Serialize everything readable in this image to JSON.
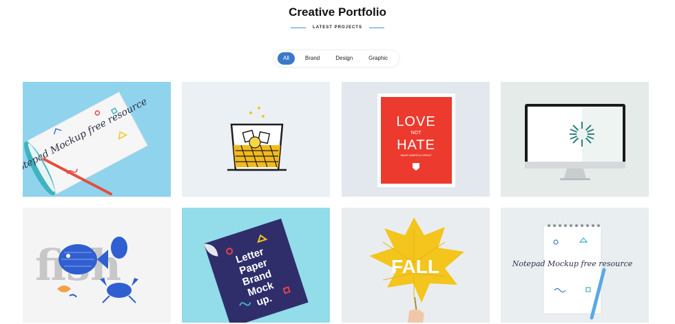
{
  "header": {
    "title": "Creative Portfolio",
    "subtitle": "LATEST PROJECTS"
  },
  "filters": {
    "items": [
      "All",
      "Brand",
      "Design",
      "Graphic"
    ],
    "active": "All"
  },
  "portfolio": {
    "items": [
      {
        "name": "notepad-mockup",
        "text": "Notepad Mockup free resource",
        "bg": "#8fd3ec"
      },
      {
        "name": "whiskey-glass",
        "text": "",
        "bg": "#eaf0f3"
      },
      {
        "name": "love-not-hate-poster",
        "text": "LOVE NOT HATE",
        "small": "MAKE AMERICA GREAT",
        "bg": "#e3e8ef"
      },
      {
        "name": "imac-mockup",
        "text": "",
        "bg": "#e5ebe9"
      },
      {
        "name": "fish-crab-art",
        "text": "fish",
        "bg": "#f4f4f4"
      },
      {
        "name": "letter-paper-mockup",
        "text": "Letter Paper Brand Mock up.",
        "bg": "#93dce9"
      },
      {
        "name": "fall-leaf",
        "text": "FALL",
        "bg": "#e9edf0"
      },
      {
        "name": "notepad-spiral",
        "text": "Notepad Mockup free resource",
        "bg": "#e9eef0"
      }
    ]
  },
  "colors": {
    "accent": "#3a78c8",
    "divider": "#3d8fd8",
    "poster_red": "#ec3a2e",
    "letter_navy": "#2f2e6b",
    "leaf_yellow": "#f3c51d"
  }
}
